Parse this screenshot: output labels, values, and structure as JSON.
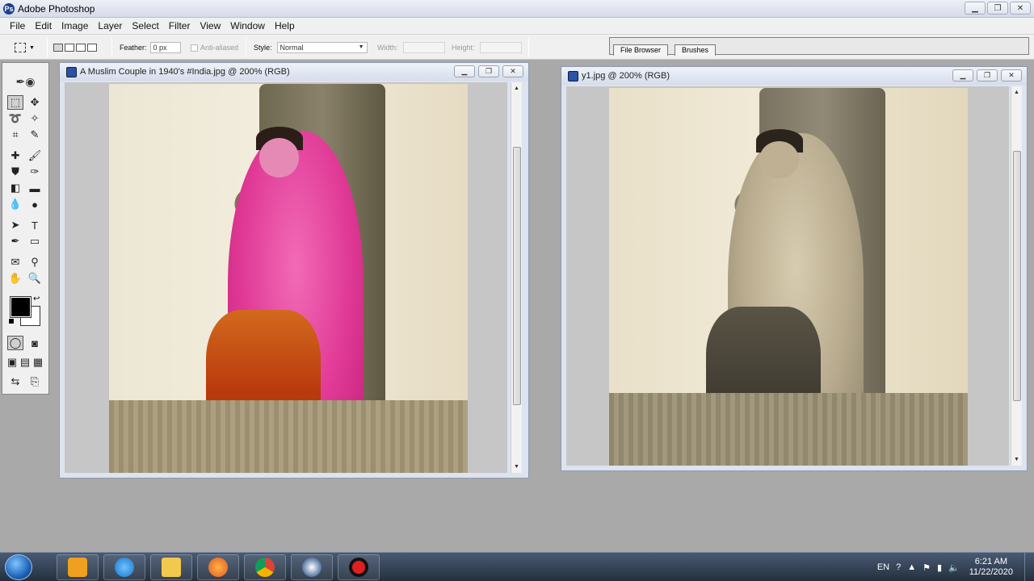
{
  "app": {
    "title": "Adobe Photoshop",
    "icon": "photoshop-icon"
  },
  "window_controls": {
    "minimize": "▁",
    "restore": "❐",
    "close": "✕"
  },
  "menu": [
    "File",
    "Edit",
    "Image",
    "Layer",
    "Select",
    "Filter",
    "View",
    "Window",
    "Help"
  ],
  "options": {
    "feather_label": "Feather:",
    "feather_value": "0 px",
    "antialiased_label": "Anti-aliased",
    "style_label": "Style:",
    "style_value": "Normal",
    "width_label": "Width:",
    "height_label": "Height:"
  },
  "palette_well": {
    "tabs": [
      "File Browser",
      "Brushes"
    ]
  },
  "documents": [
    {
      "title": "A Muslim Couple in 1940's #India.jpg @ 200% (RGB)",
      "variant": "color"
    },
    {
      "title": "y1.jpg @ 200% (RGB)",
      "variant": "sepia"
    }
  ],
  "colors": {
    "foreground": "#000000",
    "background": "#ffffff",
    "scarf_color": "#e8409a",
    "skirt_color": "#c9400f",
    "sepia_wall": "#e9dfc6"
  },
  "taskbar": {
    "language": "EN",
    "time": "6:21 AM",
    "date": "11/22/2020",
    "apps": [
      "media-player-icon",
      "internet-explorer-icon",
      "file-explorer-icon",
      "firefox-icon",
      "chrome-icon",
      "photoshop-taskbar-icon",
      "recorder-icon"
    ]
  }
}
